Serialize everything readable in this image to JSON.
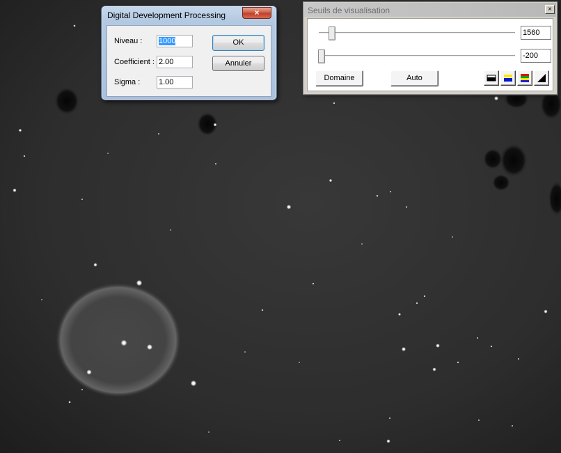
{
  "ddp_dialog": {
    "title": "Digital Development Processing",
    "close_label": "×",
    "niveau_label": "Niveau :",
    "niveau_value": "1000",
    "coefficient_label": "Coefficient :",
    "coefficient_value": "2.00",
    "sigma_label": "Sigma :",
    "sigma_value": "1.00",
    "ok_label": "OK",
    "cancel_label": "Annuler"
  },
  "seuils_window": {
    "title": "Seuils de visualisation",
    "close_label": "×",
    "high_threshold": "1560",
    "low_threshold": "-200",
    "domain_label": "Domaine",
    "auto_label": "Auto",
    "palette_buttons": [
      "black-white-palette-icon",
      "yellow-blue-palette-icon",
      "rainbow-palette-icon",
      "gradient-ramp-icon"
    ]
  },
  "colors": {
    "close_red": "#c1402a",
    "selection_blue": "#3399ff",
    "aero_frame": "#b3c9e2"
  }
}
